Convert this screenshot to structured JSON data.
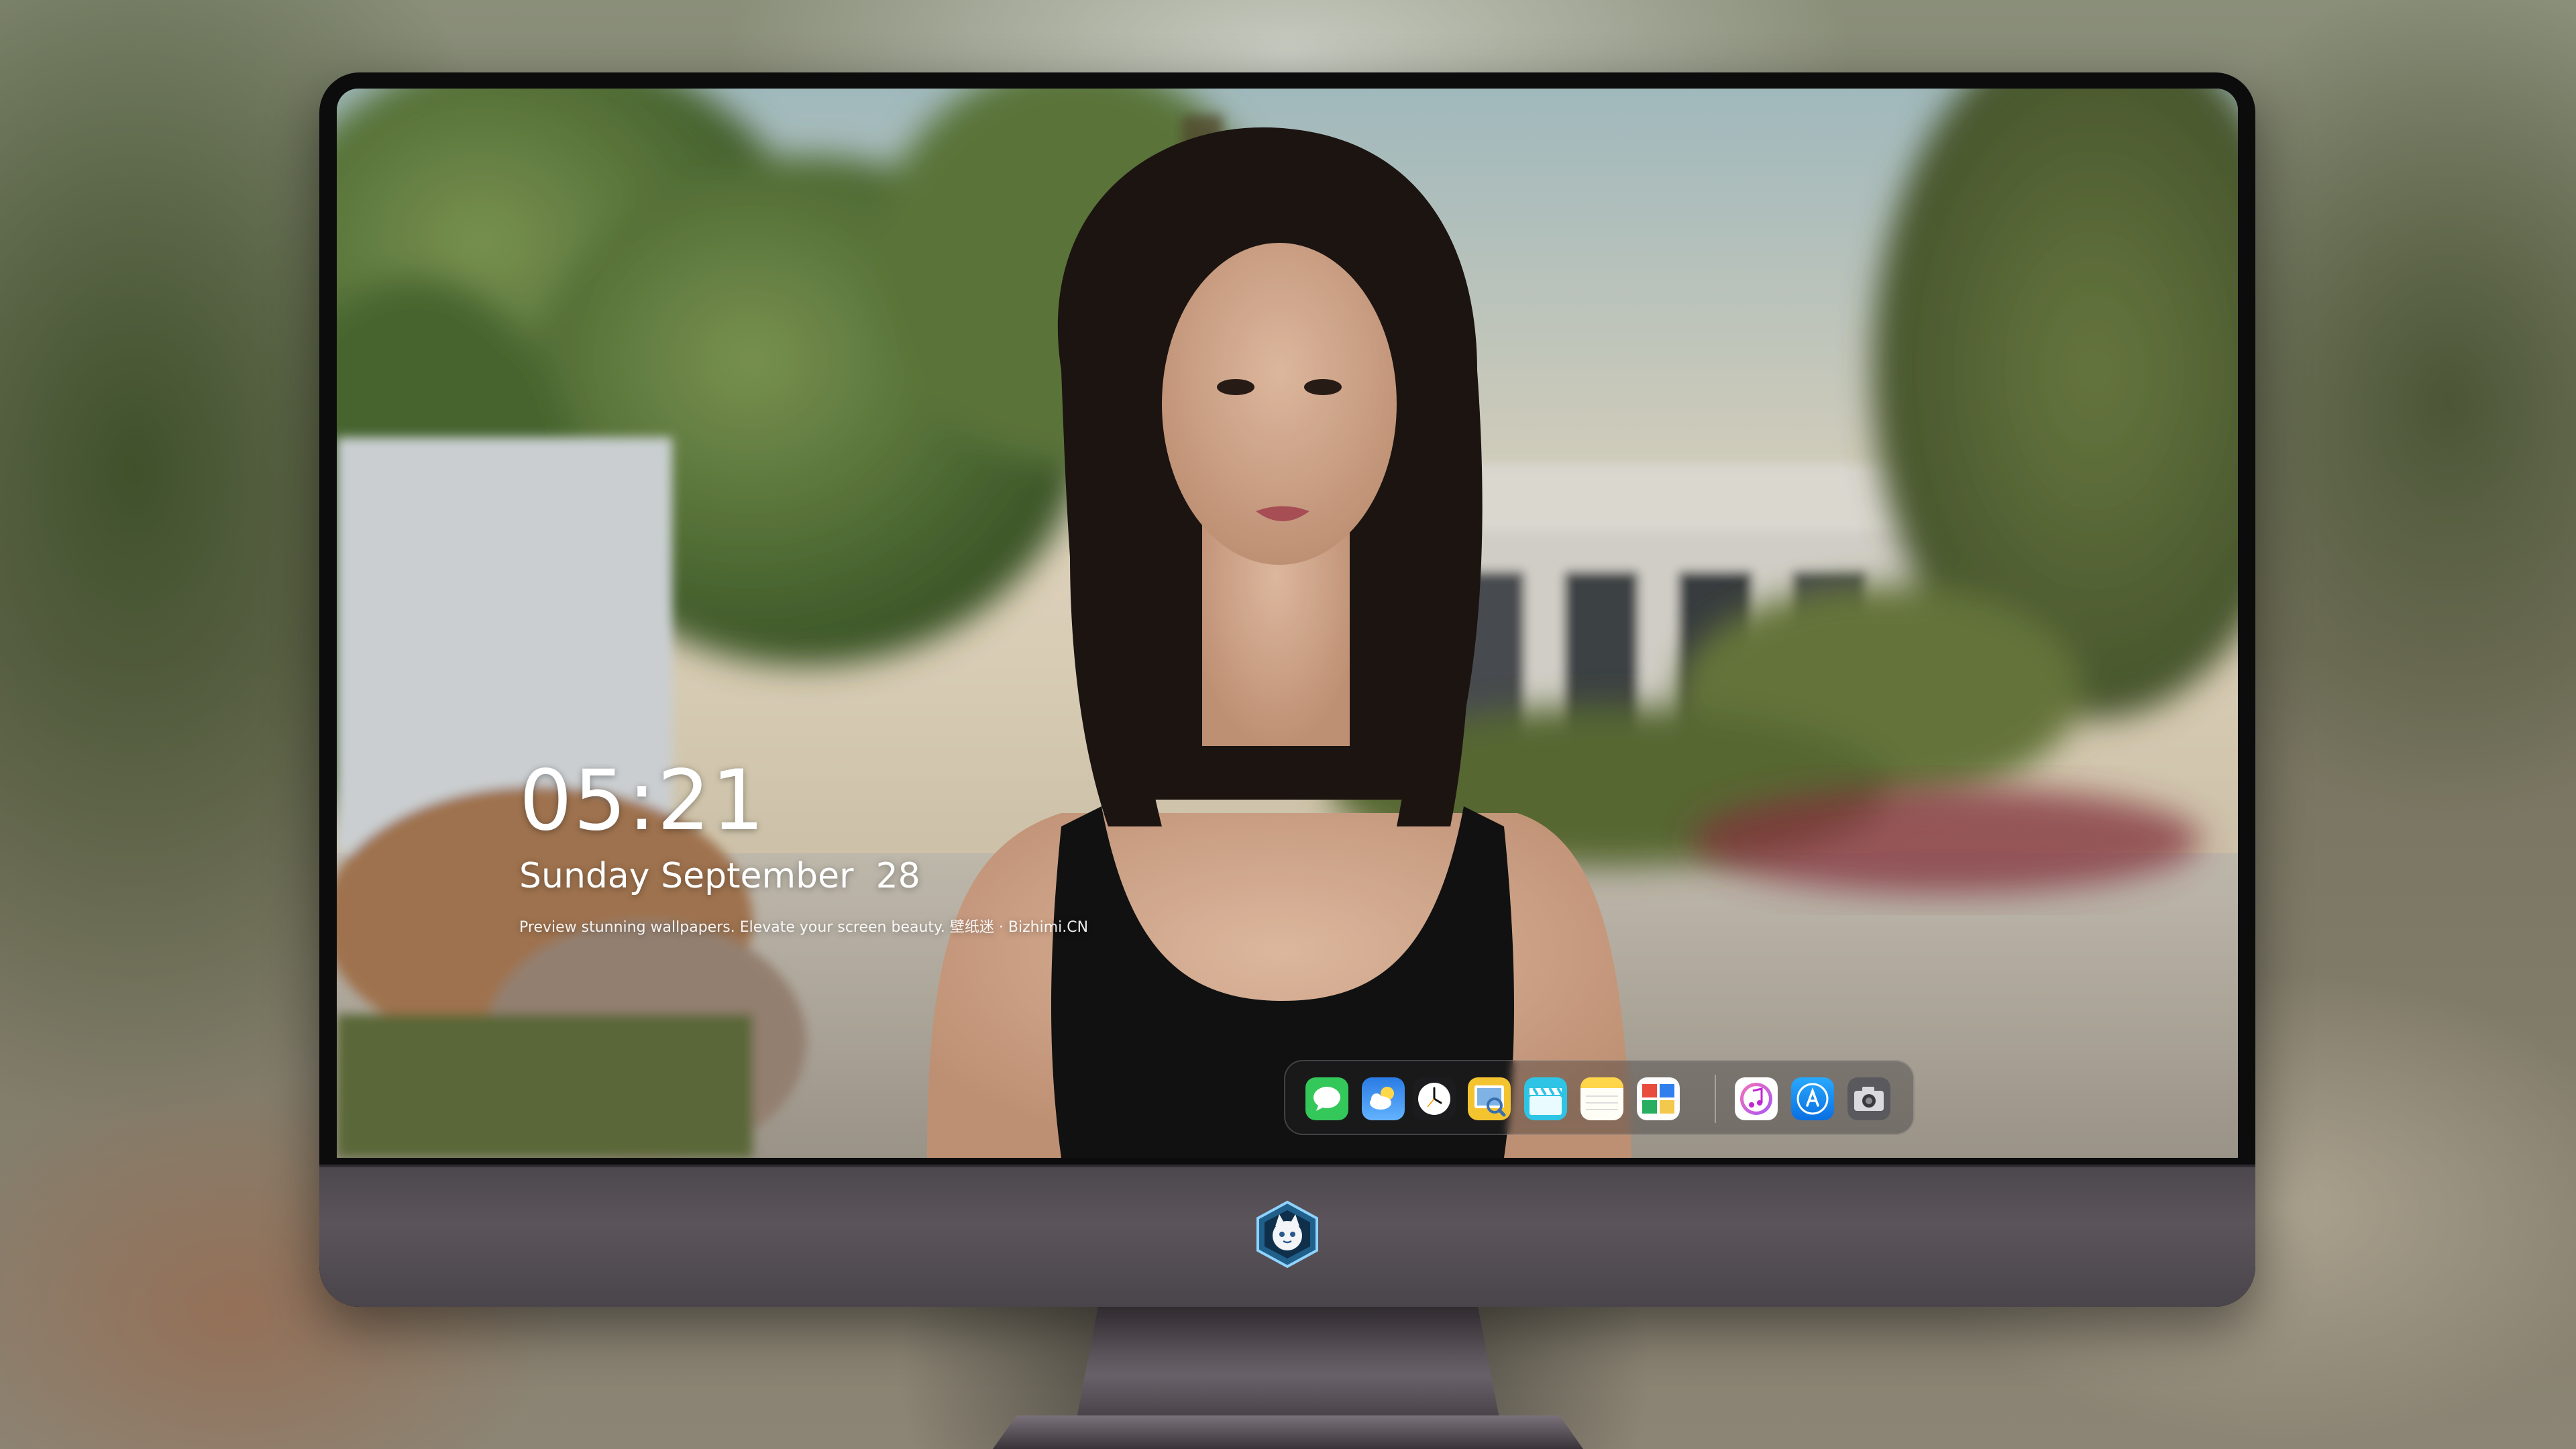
{
  "lock_screen": {
    "time": "05:21",
    "date": "Sunday September  28",
    "caption": "Preview stunning wallpapers. Elevate your screen beauty. 壁纸迷 · Bizhimi.CN"
  },
  "dock": {
    "apps": [
      {
        "name": "messages",
        "icon": "messages-icon",
        "color": "#34c759"
      },
      {
        "name": "weather",
        "icon": "weather-icon",
        "color": "#1e88e5"
      },
      {
        "name": "clock",
        "icon": "clock-icon",
        "color": "#1c1c1e"
      },
      {
        "name": "preview",
        "icon": "preview-icon",
        "color": "#f4c430"
      },
      {
        "name": "clips",
        "icon": "clapperboard-icon",
        "color": "#2ec4e6"
      },
      {
        "name": "notes",
        "icon": "notes-icon",
        "color": "#ffd54a"
      },
      {
        "name": "photo-booth",
        "icon": "photos-icon",
        "color": "#e74c3c"
      },
      {
        "name": "itunes",
        "icon": "music-icon",
        "color": "#d946ef"
      },
      {
        "name": "app-store",
        "icon": "app-store-icon",
        "color": "#1a8cff"
      },
      {
        "name": "screenshot",
        "icon": "camera-icon",
        "color": "#5a5a5e"
      }
    ]
  },
  "colors": {
    "chin": "#4d474e",
    "bezel": "#0c0c0d",
    "text": "#ffffff"
  },
  "chin": {
    "logo_icon": "mascot-badge-icon"
  }
}
